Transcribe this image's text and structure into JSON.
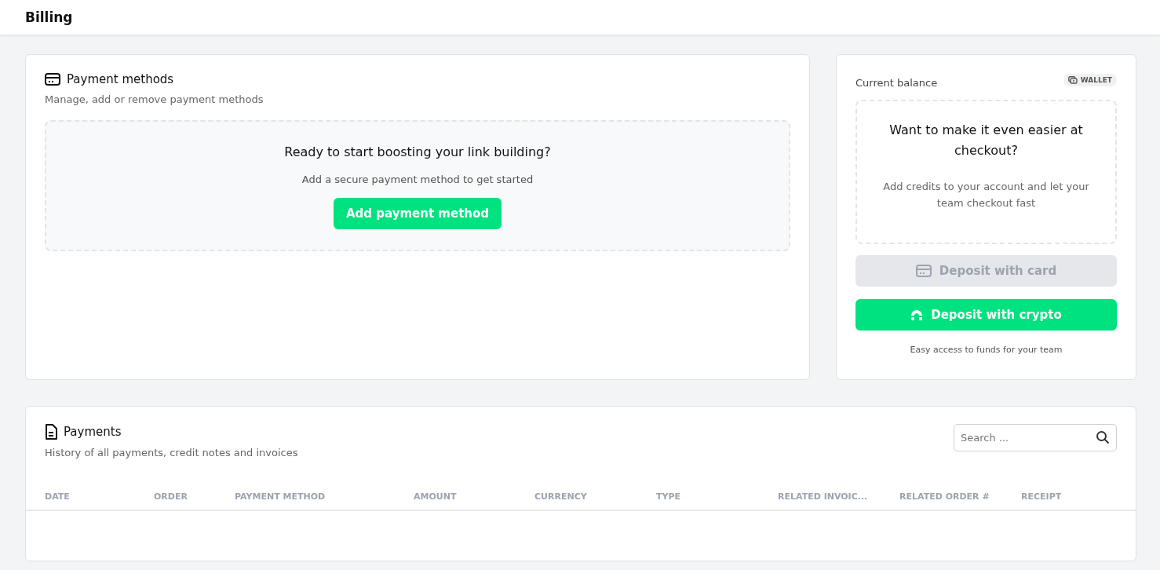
{
  "header": {
    "title": "Billing"
  },
  "payment_methods": {
    "title": "Payment methods",
    "subtitle": "Manage, add or remove payment methods",
    "empty_title": "Ready to start boosting your link building?",
    "empty_text": "Add a secure payment method to get started",
    "button": "Add payment method"
  },
  "balance": {
    "label": "Current balance",
    "badge": "WALLET",
    "promo_title": "Want to make it even easier at checkout?",
    "promo_text": "Add credits to your account and let your team checkout fast",
    "buttons": [
      {
        "label": "Deposit with card",
        "kind": "card",
        "disabled": true
      },
      {
        "label": "Deposit with crypto",
        "kind": "crypto",
        "disabled": false
      }
    ],
    "footnote": "Easy access to funds for your team"
  },
  "payments": {
    "title": "Payments",
    "subtitle": "History of all payments, credit notes and invoices",
    "search": {
      "placeholder": "Search ..."
    },
    "columns": [
      "DATE",
      "ORDER",
      "PAYMENT METHOD",
      "AMOUNT",
      "CURRENCY",
      "TYPE",
      "RELATED INVOIC...",
      "RELATED ORDER #",
      "RECEIPT"
    ]
  }
}
